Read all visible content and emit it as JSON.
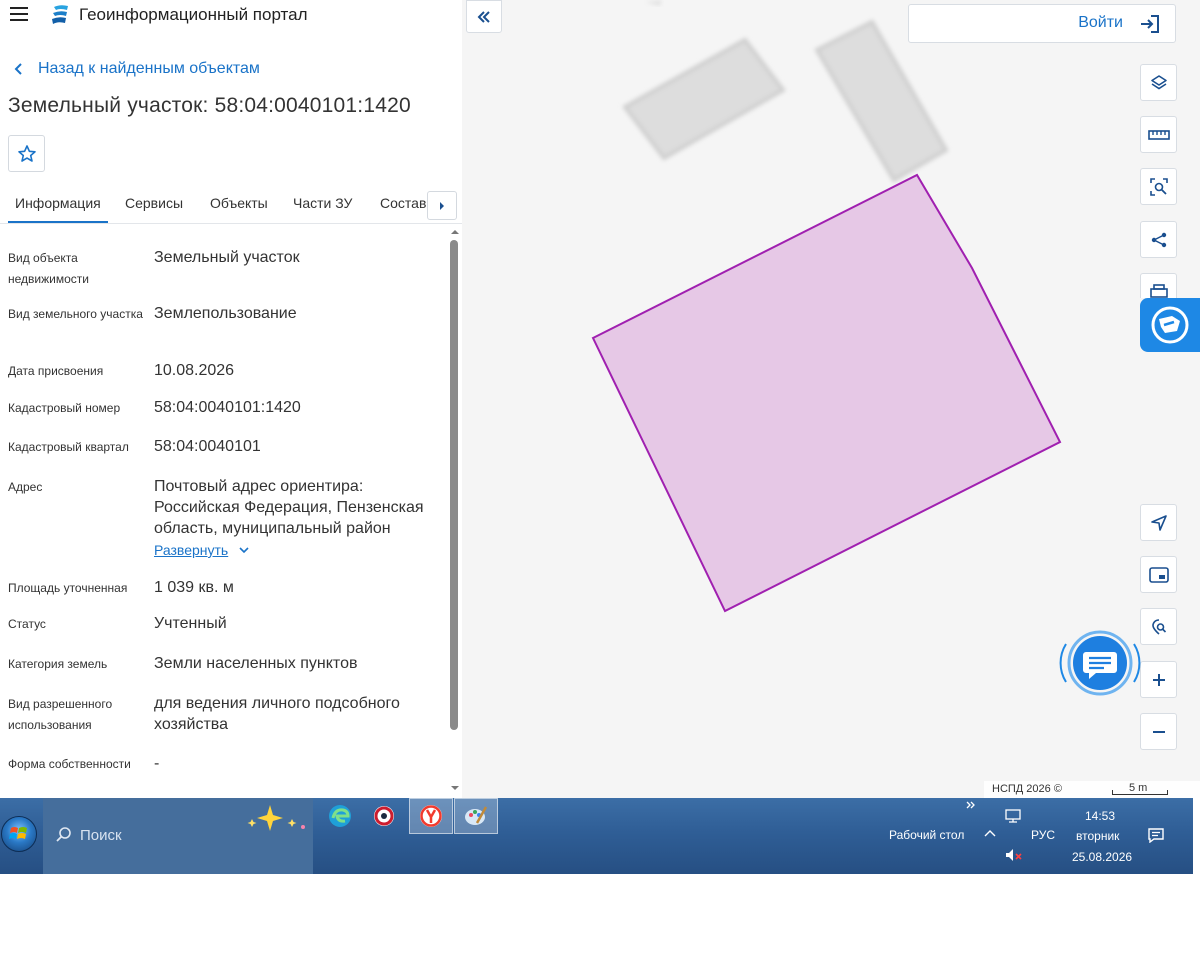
{
  "header": {
    "app_title": "Геоинформационный портал",
    "logo_icon": "portal-logo-icon",
    "menu_icon": "hamburger-icon"
  },
  "back_link": {
    "label": "Назад к найденным объектам"
  },
  "object_title": "Земельный участок: 58:04:0040101:1420",
  "tabs": [
    {
      "label": "Информация",
      "active": true
    },
    {
      "label": "Сервисы"
    },
    {
      "label": "Объекты"
    },
    {
      "label": "Части ЗУ"
    },
    {
      "label": "Состав"
    }
  ],
  "info": [
    {
      "label": "Вид объекта недвижимости",
      "value": "Земельный участок"
    },
    {
      "label": "Вид земельного участка",
      "value": "Землепользование"
    },
    {
      "label": "Дата присвоения",
      "value": "10.08.2026"
    },
    {
      "label": "Кадастровый номер",
      "value": "58:04:0040101:1420"
    },
    {
      "label": "Кадастровый квартал",
      "value": "58:04:0040101"
    },
    {
      "label": "Адрес",
      "value": "Почтовый адрес ориентира: Российская Федерация, Пензенская область, муниципальный район",
      "expand_label": "Развернуть"
    },
    {
      "label": "Площадь уточненная",
      "value": "1 039 кв. м"
    },
    {
      "label": "Статус",
      "value": "Учтенный"
    },
    {
      "label": "Категория земель",
      "value": "Земли населенных пунктов"
    },
    {
      "label": "Вид разрешенного использования",
      "value": "для ведения личного подсобного хозяйства"
    },
    {
      "label": "Форма собственности",
      "value": "-"
    }
  ],
  "map": {
    "login_label": "Войти",
    "attribution": "НСПД 2026 ©",
    "scale_label": "5 m",
    "parcel_fill": "#e6c8e6",
    "parcel_stroke": "#a020b0",
    "tools": [
      "layers-icon",
      "ruler-icon",
      "area-search-icon",
      "share-icon",
      "print-icon",
      "gosuslugi-icon",
      "locate-icon",
      "minimap-icon",
      "geo-search-icon",
      "zoom-in-icon",
      "zoom-out-icon"
    ]
  },
  "taskbar": {
    "search_placeholder": "Поиск",
    "desktop_label": "Рабочий стол",
    "language": "РУС",
    "time": "14:53",
    "weekday": "вторник",
    "date": "25.08.2026",
    "apps": [
      "edge-icon",
      "opera-icon",
      "yandex-browser-icon",
      "paint-icon"
    ]
  },
  "colors": {
    "accent": "#1a73c8",
    "taskbar": "#2f5e96"
  }
}
